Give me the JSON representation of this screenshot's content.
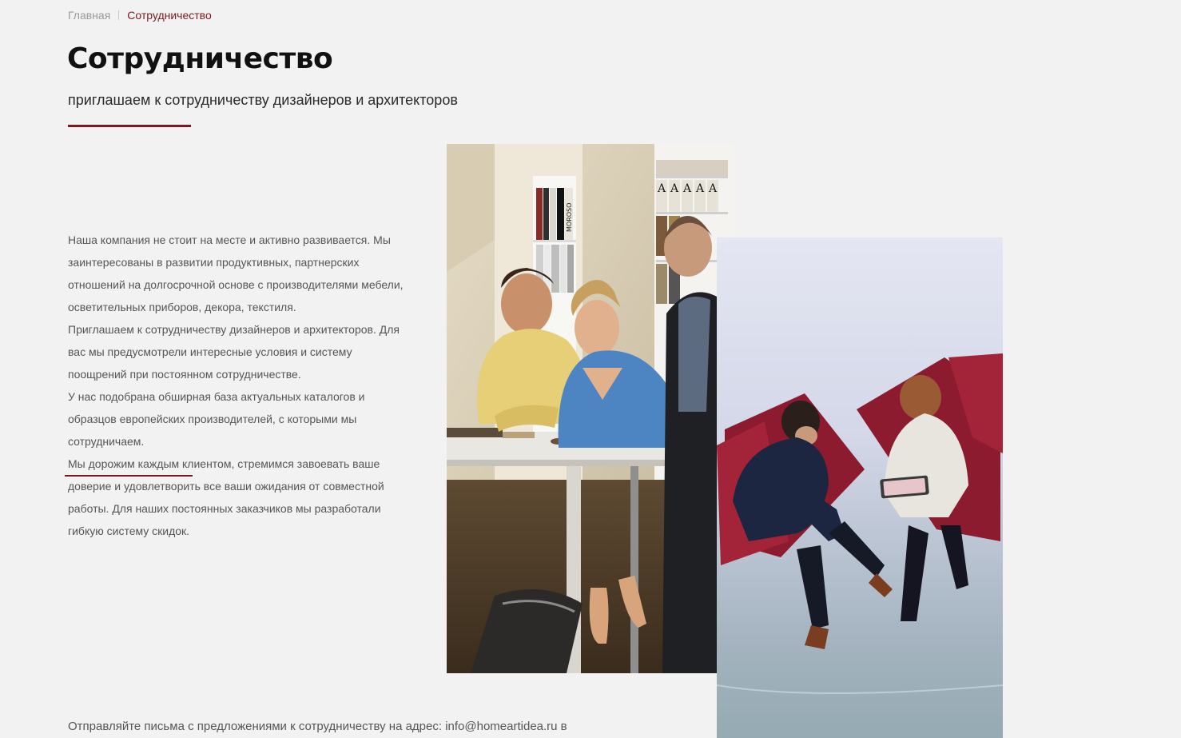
{
  "breadcrumb": {
    "home": "Главная",
    "current": "Сотрудничество"
  },
  "page": {
    "title": "Сотрудничество",
    "subtitle": "приглашаем к сотрудничеству дизайнеров и архитекторов"
  },
  "body": {
    "paragraphs": [
      "Наша компания не стоит на месте и активно развивается. Мы заинтересованы в развитии продуктивных, партнерских отношений на долгосрочной основе с производителями мебели, осветительных приборов, декора, текстиля.",
      "Приглашаем к сотрудничеству дизайнеров и архитекторов. Для вас мы предусмотрели интересные условия и систему поощрений при постоянном сотрудничестве.",
      "У нас подобрана обширная база актуальных каталогов и образцов европейских производителей, с которыми мы сотрудничаем.",
      "Мы дорожим каждым клиентом, стремимся завоевать ваше доверие и удовлетворить все ваши ожидания от совместной работы. Для наших постоянных заказчиков мы разработали гибкую систему скидок."
    ]
  },
  "images": {
    "office_photo_text": [
      "MOROSO",
      "A",
      "A",
      "A",
      "A",
      "A"
    ]
  },
  "footer": {
    "text_before": "Отправляйте письма с предложениями к сотрудничеству на адрес: ",
    "email": "info@homeartidea.ru",
    "text_after": " в"
  },
  "colors": {
    "accent": "#7a1a1f",
    "background": "#f2f2f2",
    "title": "#111111",
    "body_text": "#555555"
  }
}
